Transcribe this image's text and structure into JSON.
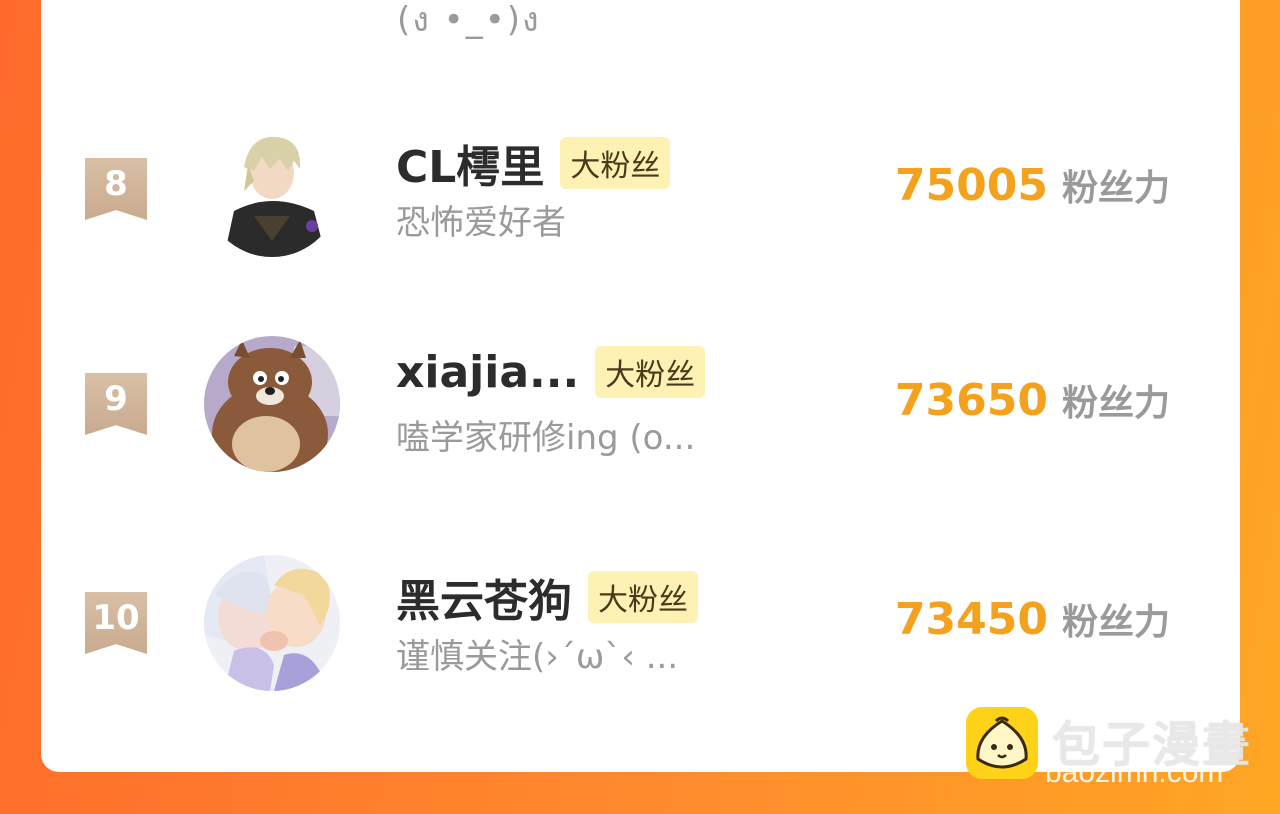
{
  "top_partial": {
    "subtitle_fragment": "(ง •_•)ง"
  },
  "ranking": [
    {
      "rank": "8",
      "name": "CL樗里",
      "badge": "大粉丝",
      "subtitle": "恐怖爱好者",
      "score": "75005",
      "unit": "粉丝力",
      "avatar": "anime-character-blond-dark-coat"
    },
    {
      "rank": "9",
      "name": "xiajia...",
      "badge": "大粉丝",
      "subtitle": "嗑学家研修ing (o...",
      "score": "73650",
      "unit": "粉丝力",
      "avatar": "cartoon-bear"
    },
    {
      "rank": "10",
      "name": "黑云苍狗",
      "badge": "大粉丝",
      "subtitle": "谨慎关注(›´ω`‹ ...",
      "score": "73450",
      "unit": "粉丝力",
      "avatar": "anime-couple-kiss"
    }
  ],
  "watermark": {
    "title": "包子漫畫",
    "url": "baozimh.com",
    "icon": "baozi-bun-icon"
  },
  "colors": {
    "background_start": "#ff6a2a",
    "background_end": "#ffa623",
    "score": "#f4a21e",
    "badge_bg": "#fdf1b3",
    "rank_ribbon": "#d3b99f"
  }
}
